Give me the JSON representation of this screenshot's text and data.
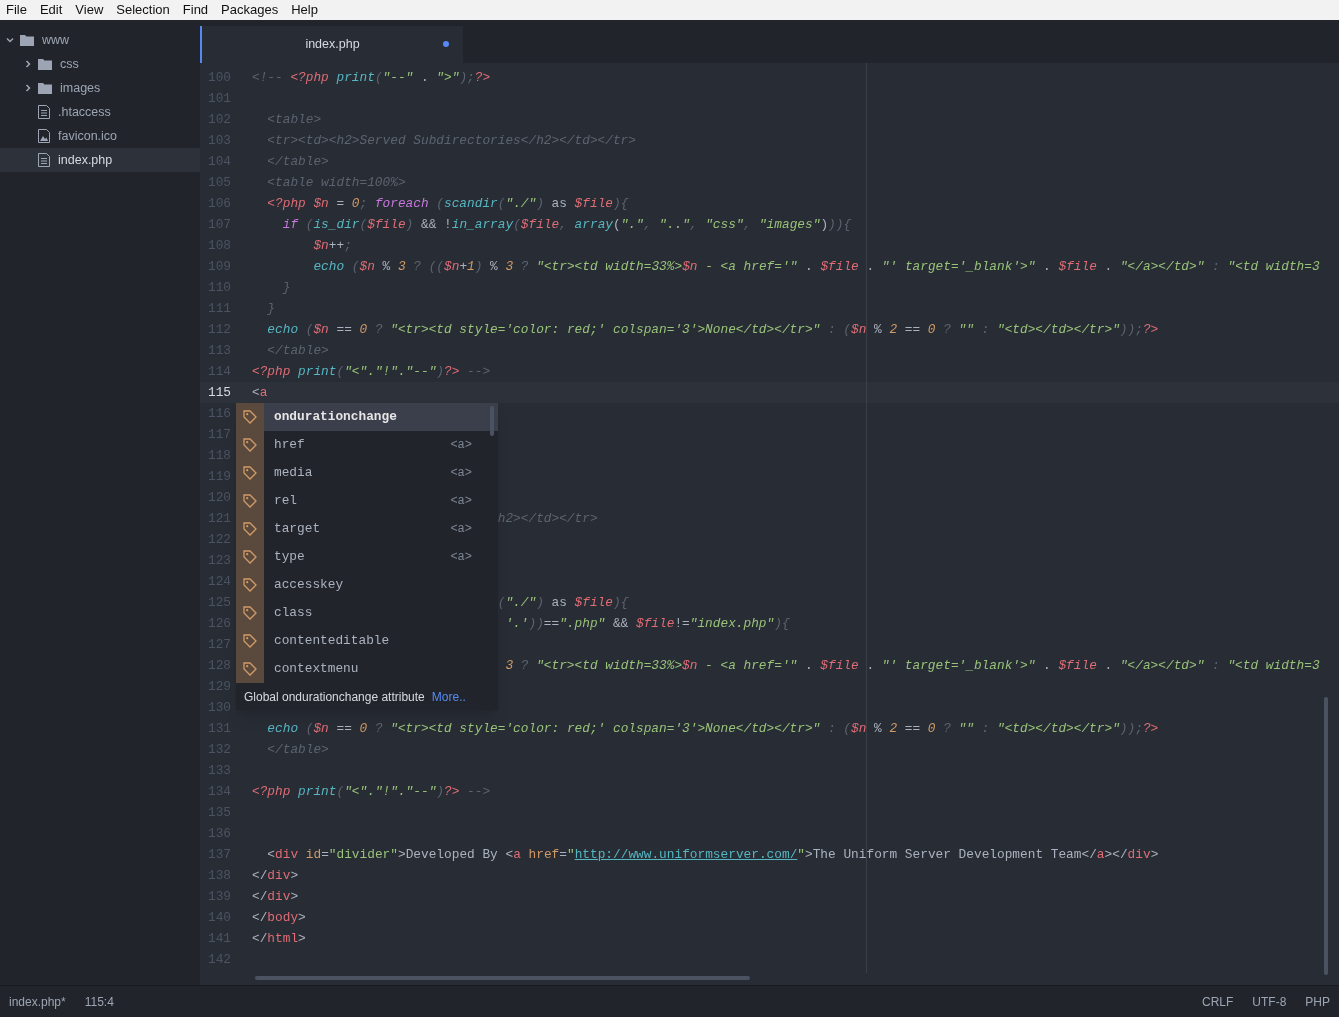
{
  "menu": [
    "File",
    "Edit",
    "View",
    "Selection",
    "Find",
    "Packages",
    "Help"
  ],
  "tree": [
    {
      "name": "www",
      "kind": "folder",
      "expanded": true,
      "selected": false,
      "children": [
        {
          "name": "css",
          "kind": "folder",
          "expanded": false,
          "selected": false
        },
        {
          "name": "images",
          "kind": "folder",
          "expanded": false,
          "selected": false
        },
        {
          "name": ".htaccess",
          "kind": "file",
          "selected": false
        },
        {
          "name": "favicon.ico",
          "kind": "image",
          "selected": false
        },
        {
          "name": "index.php",
          "kind": "file",
          "selected": true
        }
      ]
    }
  ],
  "tabs": [
    {
      "title": "index.php",
      "selected": true,
      "modified": true
    }
  ],
  "lines": [
    {
      "number": "100",
      "current": false,
      "tokens": [
        {
          "kind": "c",
          "text": "<!-- "
        },
        {
          "kind": "t",
          "text": "<?php "
        },
        {
          "kind": "f",
          "text": "print"
        },
        {
          "kind": "p",
          "text": "("
        },
        {
          "kind": "s",
          "text": "\"--\""
        },
        {
          "kind": "o",
          "text": " . "
        },
        {
          "kind": "s",
          "text": "\">\""
        },
        {
          "kind": "p",
          "text": ");"
        },
        {
          "kind": "t",
          "text": "?>"
        }
      ]
    },
    {
      "number": "101",
      "current": false
    },
    {
      "number": "102",
      "current": false,
      "tokens": [
        {
          "kind": "c",
          "text": "  <table>"
        }
      ]
    },
    {
      "number": "103",
      "current": false,
      "tokens": [
        {
          "kind": "c",
          "text": "  <tr><td><h2>Served Subdirectories</h2></td></tr>"
        }
      ]
    },
    {
      "number": "104",
      "current": false,
      "tokens": [
        {
          "kind": "c",
          "text": "  </table>"
        }
      ]
    },
    {
      "number": "105",
      "current": false,
      "tokens": [
        {
          "kind": "c",
          "text": "  <table width=100%>"
        }
      ]
    },
    {
      "number": "106",
      "current": false,
      "tokens": [
        {
          "kind": "t",
          "text": "  <?php "
        },
        {
          "kind": "v",
          "text": "$n"
        },
        {
          "kind": "o",
          "text": " = "
        },
        {
          "kind": "n",
          "text": "0"
        },
        {
          "kind": "p",
          "text": "; "
        },
        {
          "kind": "k",
          "text": "foreach"
        },
        {
          "kind": "p",
          "text": " ("
        },
        {
          "kind": "f",
          "text": "scandir"
        },
        {
          "kind": "p",
          "text": "("
        },
        {
          "kind": "s",
          "text": "\"./\""
        },
        {
          "kind": "p",
          "text": ")"
        },
        {
          "kind": "o",
          "text": " as "
        },
        {
          "kind": "v",
          "text": "$file"
        },
        {
          "kind": "p",
          "text": "){"
        }
      ]
    },
    {
      "number": "107",
      "current": false,
      "tokens": [
        {
          "kind": "k",
          "text": "    if"
        },
        {
          "kind": "p",
          "text": " ("
        },
        {
          "kind": "f",
          "text": "is_dir"
        },
        {
          "kind": "p",
          "text": "("
        },
        {
          "kind": "v",
          "text": "$file"
        },
        {
          "kind": "p",
          "text": ")"
        },
        {
          "kind": "o",
          "text": " && !"
        },
        {
          "kind": "f",
          "text": "in_array"
        },
        {
          "kind": "p",
          "text": "("
        },
        {
          "kind": "v",
          "text": "$file"
        },
        {
          "kind": "p",
          "text": ", "
        },
        {
          "kind": "f",
          "text": "array"
        },
        {
          "kind": "o",
          "text": "("
        },
        {
          "kind": "s",
          "text": "\".\""
        },
        {
          "kind": "p",
          "text": ", "
        },
        {
          "kind": "s",
          "text": "\"..\""
        },
        {
          "kind": "p",
          "text": ", "
        },
        {
          "kind": "s",
          "text": "\"css\""
        },
        {
          "kind": "p",
          "text": ", "
        },
        {
          "kind": "s",
          "text": "\"images\""
        },
        {
          "kind": "o",
          "text": ")"
        },
        {
          "kind": "p",
          "text": ")){"
        }
      ]
    },
    {
      "number": "108",
      "current": false,
      "tokens": [
        {
          "kind": "v",
          "text": "        $n"
        },
        {
          "kind": "o",
          "text": "++"
        },
        {
          "kind": "p",
          "text": ";"
        }
      ]
    },
    {
      "number": "109",
      "current": false,
      "tokens": [
        {
          "kind": "f",
          "text": "        echo"
        },
        {
          "kind": "p",
          "text": " ("
        },
        {
          "kind": "v",
          "text": "$n"
        },
        {
          "kind": "o",
          "text": " % "
        },
        {
          "kind": "n",
          "text": "3"
        },
        {
          "kind": "p",
          "text": " ? (("
        },
        {
          "kind": "v",
          "text": "$n"
        },
        {
          "kind": "o",
          "text": "+"
        },
        {
          "kind": "n",
          "text": "1"
        },
        {
          "kind": "p",
          "text": ")"
        },
        {
          "kind": "o",
          "text": " % "
        },
        {
          "kind": "n",
          "text": "3"
        },
        {
          "kind": "p",
          "text": " ? "
        },
        {
          "kind": "s",
          "text": "\"<tr><td width=33%>"
        },
        {
          "kind": "v",
          "text": "$n"
        },
        {
          "kind": "s",
          "text": " - <a href='\""
        },
        {
          "kind": "o",
          "text": " . "
        },
        {
          "kind": "v",
          "text": "$file"
        },
        {
          "kind": "o",
          "text": " . "
        },
        {
          "kind": "s",
          "text": "\"' target='_blank'>\""
        },
        {
          "kind": "o",
          "text": " . "
        },
        {
          "kind": "v",
          "text": "$file"
        },
        {
          "kind": "o",
          "text": " . "
        },
        {
          "kind": "s",
          "text": "\"</a></td>\""
        },
        {
          "kind": "p",
          "text": " : "
        },
        {
          "kind": "s",
          "text": "\"<td width=3"
        }
      ]
    },
    {
      "number": "110",
      "current": false,
      "tokens": [
        {
          "kind": "p",
          "text": "    }"
        }
      ]
    },
    {
      "number": "111",
      "current": false,
      "tokens": [
        {
          "kind": "p",
          "text": "  }"
        }
      ]
    },
    {
      "number": "112",
      "current": false,
      "tokens": [
        {
          "kind": "f",
          "text": "  echo"
        },
        {
          "kind": "p",
          "text": " ("
        },
        {
          "kind": "v",
          "text": "$n"
        },
        {
          "kind": "o",
          "text": " == "
        },
        {
          "kind": "n",
          "text": "0"
        },
        {
          "kind": "p",
          "text": " ? "
        },
        {
          "kind": "s",
          "text": "\"<tr><td style='color: red;' colspan='3'>None</td></tr>\""
        },
        {
          "kind": "p",
          "text": " : ("
        },
        {
          "kind": "v",
          "text": "$n"
        },
        {
          "kind": "o",
          "text": " % "
        },
        {
          "kind": "n",
          "text": "2"
        },
        {
          "kind": "o",
          "text": " == "
        },
        {
          "kind": "n",
          "text": "0"
        },
        {
          "kind": "p",
          "text": " ? "
        },
        {
          "kind": "s",
          "text": "\"\""
        },
        {
          "kind": "p",
          "text": " : "
        },
        {
          "kind": "s",
          "text": "\"<td></td></tr>\""
        },
        {
          "kind": "p",
          "text": "));"
        },
        {
          "kind": "t",
          "text": "?>"
        }
      ]
    },
    {
      "number": "113",
      "current": false,
      "tokens": [
        {
          "kind": "c",
          "text": "  </table>"
        }
      ]
    },
    {
      "number": "114",
      "current": false,
      "tokens": [
        {
          "kind": "t",
          "text": "<?php "
        },
        {
          "kind": "f",
          "text": "print"
        },
        {
          "kind": "p",
          "text": "("
        },
        {
          "kind": "s",
          "text": "\"<\".\"!\".\"--\""
        },
        {
          "kind": "p",
          "text": ")"
        },
        {
          "kind": "t",
          "text": "?>"
        },
        {
          "kind": "c",
          "text": " -->"
        }
      ]
    },
    {
      "number": "115",
      "current": true,
      "tokens": [
        {
          "kind": "o",
          "text": "<"
        },
        {
          "kind": "h",
          "text": "a"
        }
      ]
    },
    {
      "number": "116",
      "current": false
    },
    {
      "number": "117",
      "current": false
    },
    {
      "number": "118",
      "current": false
    },
    {
      "number": "119",
      "current": false
    },
    {
      "number": "120",
      "current": false
    },
    {
      "number": "121",
      "current": false,
      "tokens": [
        {
          "kind": "c",
          "text": "                                h2></td></tr>"
        }
      ]
    },
    {
      "number": "122",
      "current": false
    },
    {
      "number": "123",
      "current": false
    },
    {
      "number": "124",
      "current": false
    },
    {
      "number": "125",
      "current": false,
      "tokens": [
        {
          "kind": "p",
          "text": "                                ("
        },
        {
          "kind": "s",
          "text": "\"./\""
        },
        {
          "kind": "p",
          "text": ")"
        },
        {
          "kind": "o",
          "text": " as "
        },
        {
          "kind": "v",
          "text": "$file"
        },
        {
          "kind": "p",
          "text": "){"
        }
      ]
    },
    {
      "number": "126",
      "current": false,
      "tokens": [
        {
          "kind": "s",
          "text": "                                 '.'"
        },
        {
          "kind": "p",
          "text": "))"
        },
        {
          "kind": "o",
          "text": "=="
        },
        {
          "kind": "s",
          "text": "\".php\""
        },
        {
          "kind": "o",
          "text": " && "
        },
        {
          "kind": "v",
          "text": "$file"
        },
        {
          "kind": "o",
          "text": "!="
        },
        {
          "kind": "s",
          "text": "\"index.php\""
        },
        {
          "kind": "p",
          "text": "){"
        }
      ]
    },
    {
      "number": "127",
      "current": false
    },
    {
      "number": "128",
      "current": false,
      "tokens": [
        {
          "kind": "n",
          "text": "                                 3"
        },
        {
          "kind": "p",
          "text": " ? "
        },
        {
          "kind": "s",
          "text": "\"<tr><td width=33%>"
        },
        {
          "kind": "v",
          "text": "$n"
        },
        {
          "kind": "s",
          "text": " - <a href='\""
        },
        {
          "kind": "o",
          "text": " . "
        },
        {
          "kind": "v",
          "text": "$file"
        },
        {
          "kind": "o",
          "text": " . "
        },
        {
          "kind": "s",
          "text": "\"' target='_blank'>\""
        },
        {
          "kind": "o",
          "text": " . "
        },
        {
          "kind": "v",
          "text": "$file"
        },
        {
          "kind": "o",
          "text": " . "
        },
        {
          "kind": "s",
          "text": "\"</a></td>\""
        },
        {
          "kind": "p",
          "text": " : "
        },
        {
          "kind": "s",
          "text": "\"<td width=3"
        }
      ]
    },
    {
      "number": "129",
      "current": false
    },
    {
      "number": "130",
      "current": false
    },
    {
      "number": "131",
      "current": false,
      "tokens": [
        {
          "kind": "f",
          "text": "  echo"
        },
        {
          "kind": "p",
          "text": " ("
        },
        {
          "kind": "v",
          "text": "$n"
        },
        {
          "kind": "o",
          "text": " == "
        },
        {
          "kind": "n",
          "text": "0"
        },
        {
          "kind": "p",
          "text": " ? "
        },
        {
          "kind": "s",
          "text": "\"<tr><td style='color: red;' colspan='3'>None</td></tr>\""
        },
        {
          "kind": "p",
          "text": " : ("
        },
        {
          "kind": "v",
          "text": "$n"
        },
        {
          "kind": "o",
          "text": " % "
        },
        {
          "kind": "n",
          "text": "2"
        },
        {
          "kind": "o",
          "text": " == "
        },
        {
          "kind": "n",
          "text": "0"
        },
        {
          "kind": "p",
          "text": " ? "
        },
        {
          "kind": "s",
          "text": "\"\""
        },
        {
          "kind": "p",
          "text": " : "
        },
        {
          "kind": "s",
          "text": "\"<td></td></tr>\""
        },
        {
          "kind": "p",
          "text": "));"
        },
        {
          "kind": "t",
          "text": "?>"
        }
      ]
    },
    {
      "number": "132",
      "current": false,
      "tokens": [
        {
          "kind": "c",
          "text": "  </table>"
        }
      ]
    },
    {
      "number": "133",
      "current": false
    },
    {
      "number": "134",
      "current": false,
      "tokens": [
        {
          "kind": "t",
          "text": "<?php "
        },
        {
          "kind": "f",
          "text": "print"
        },
        {
          "kind": "p",
          "text": "("
        },
        {
          "kind": "s",
          "text": "\"<\".\"!\".\"--\""
        },
        {
          "kind": "p",
          "text": ")"
        },
        {
          "kind": "t",
          "text": "?>"
        },
        {
          "kind": "c",
          "text": " -->"
        }
      ]
    },
    {
      "number": "135",
      "current": false
    },
    {
      "number": "136",
      "current": false
    },
    {
      "number": "137",
      "current": false,
      "tokens": [
        {
          "kind": "o",
          "text": "  <"
        },
        {
          "kind": "h",
          "text": "div"
        },
        {
          "kind": "a",
          "text": " id"
        },
        {
          "kind": "o",
          "text": "="
        },
        {
          "kind": "q",
          "text": "\"divider\""
        },
        {
          "kind": "o",
          "text": ">Developed By <"
        },
        {
          "kind": "h",
          "text": "a"
        },
        {
          "kind": "a",
          "text": " href"
        },
        {
          "kind": "o",
          "text": "="
        },
        {
          "kind": "q",
          "text": "\""
        },
        {
          "kind": "l",
          "text": "http://www.uniformserver.com/"
        },
        {
          "kind": "q",
          "text": "\""
        },
        {
          "kind": "o",
          "text": ">The Uniform Server Development Team</"
        },
        {
          "kind": "h",
          "text": "a"
        },
        {
          "kind": "o",
          "text": "></"
        },
        {
          "kind": "h",
          "text": "div"
        },
        {
          "kind": "o",
          "text": ">"
        }
      ]
    },
    {
      "number": "138",
      "current": false,
      "tokens": [
        {
          "kind": "o",
          "text": "</"
        },
        {
          "kind": "h",
          "text": "div"
        },
        {
          "kind": "o",
          "text": ">"
        }
      ]
    },
    {
      "number": "139",
      "current": false,
      "tokens": [
        {
          "kind": "o",
          "text": "</"
        },
        {
          "kind": "h",
          "text": "div"
        },
        {
          "kind": "o",
          "text": ">"
        }
      ]
    },
    {
      "number": "140",
      "current": false,
      "tokens": [
        {
          "kind": "o",
          "text": "</"
        },
        {
          "kind": "h",
          "text": "body"
        },
        {
          "kind": "o",
          "text": ">"
        }
      ]
    },
    {
      "number": "141",
      "current": false,
      "tokens": [
        {
          "kind": "o",
          "text": "</"
        },
        {
          "kind": "h",
          "text": "html"
        },
        {
          "kind": "o",
          "text": ">"
        }
      ]
    },
    {
      "number": "142",
      "current": false
    }
  ],
  "autocomplete": {
    "items": [
      {
        "label": "ondurationchange",
        "selected": true
      },
      {
        "label": "href",
        "detail": "<a>",
        "selected": false
      },
      {
        "label": "media",
        "detail": "<a>",
        "selected": false
      },
      {
        "label": "rel",
        "detail": "<a>",
        "selected": false
      },
      {
        "label": "target",
        "detail": "<a>",
        "selected": false
      },
      {
        "label": "type",
        "detail": "<a>",
        "selected": false
      },
      {
        "label": "accesskey",
        "selected": false
      },
      {
        "label": "class",
        "selected": false
      },
      {
        "label": "contenteditable",
        "selected": false
      },
      {
        "label": "contextmenu",
        "selected": false
      }
    ],
    "description": "Global ondurationchange attribute",
    "more_link": "More.."
  },
  "status_bar": {
    "left": [
      "index.php*",
      "115:4"
    ],
    "right": [
      "CRLF",
      "UTF-8",
      "PHP"
    ]
  }
}
